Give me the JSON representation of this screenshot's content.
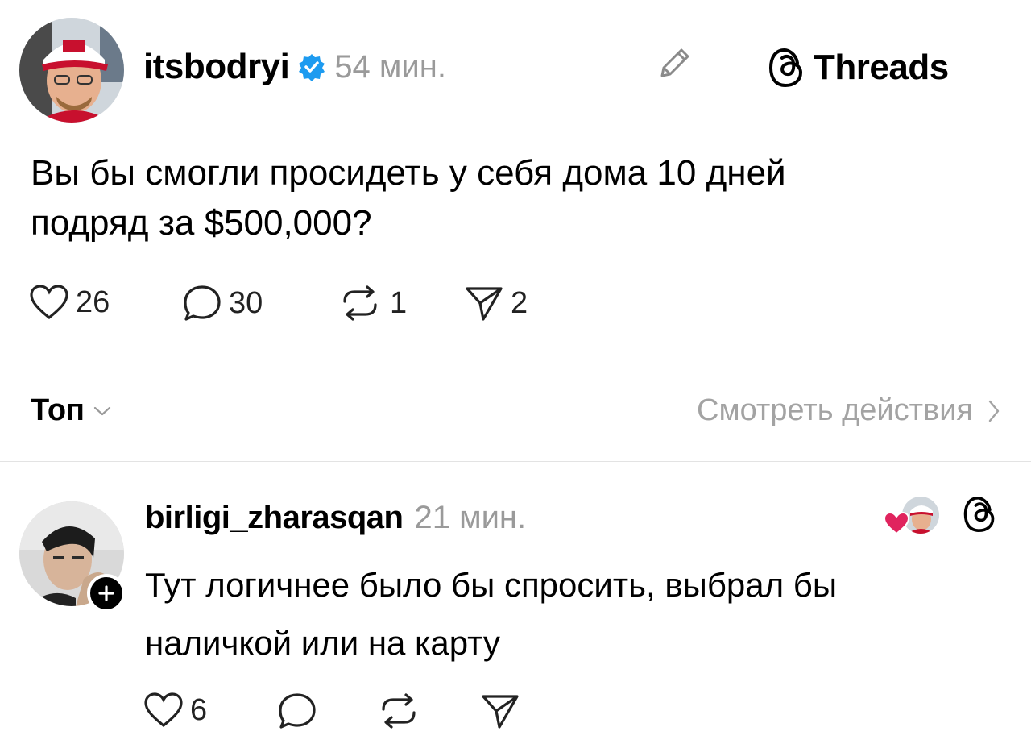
{
  "post": {
    "username": "itsbodryi",
    "verified": true,
    "time": "54 мин.",
    "brand_label": "Threads",
    "text_line1": "Вы бы смогли  просидеть у себя дома 10 дней",
    "text_line2": "подряд за $500,000?",
    "likes": "26",
    "comments": "30",
    "reposts": "1",
    "shares": "2"
  },
  "replies_header": {
    "sort_label": "Топ",
    "activity_label": "Смотреть действия"
  },
  "reply": {
    "username": "birligi_zharasqan",
    "time": "21 мин.",
    "text_line1": "Тут логичнее было бы спросить, выбрал бы",
    "text_line2": "наличкой или на карту",
    "likes": "6"
  },
  "colors": {
    "verified": "#1d9bf0",
    "like_heart": "#e0245e",
    "muted": "#9a9a9a"
  }
}
